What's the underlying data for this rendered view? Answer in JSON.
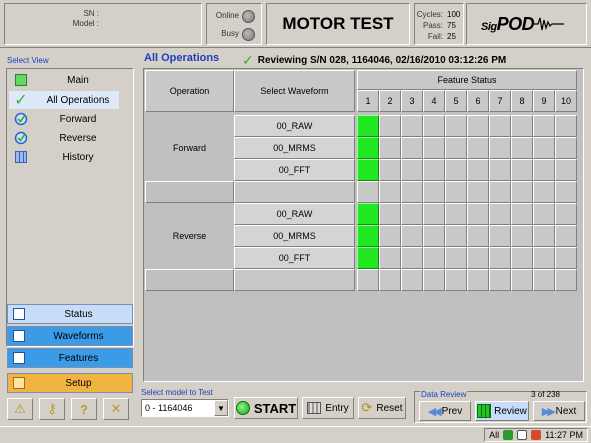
{
  "header": {
    "sn_label": "SN :",
    "model_label": "Model :",
    "online_label": "Online",
    "busy_label": "Busy",
    "title": "MOTOR TEST",
    "cycles_label": "Cycles:",
    "cycles_value": "100",
    "pass_label": "Pass:",
    "pass_value": "75",
    "fail_label": "Fail:",
    "fail_value": "25",
    "logo_pre": "Sig",
    "logo_main": "POD"
  },
  "sidebar": {
    "select_view_label": "Select View",
    "items": [
      {
        "label": "Main",
        "icon": "main-view-icon"
      },
      {
        "label": "All Operations",
        "icon": "check-icon"
      },
      {
        "label": "Forward",
        "icon": "forward-op-icon"
      },
      {
        "label": "Reverse",
        "icon": "reverse-op-icon"
      },
      {
        "label": "History",
        "icon": "history-icon"
      }
    ],
    "active_index": 1,
    "buttons": {
      "status": "Status",
      "waveforms": "Waveforms",
      "features": "Features",
      "setup": "Setup"
    },
    "tool_icons": [
      "warning-icon",
      "key-icon",
      "help-icon",
      "tools-icon"
    ]
  },
  "main": {
    "title": "All Operations",
    "review_text": "Reviewing S/N 028, 1164046, 02/16/2010 03:12:26 PM",
    "table": {
      "col_operation": "Operation",
      "col_waveform": "Select Waveform",
      "col_feature_status": "Feature Status",
      "feature_numbers": [
        "1",
        "2",
        "3",
        "4",
        "5",
        "6",
        "7",
        "8",
        "9",
        "10"
      ],
      "groups": [
        {
          "operation": "Forward",
          "rows": [
            {
              "waveform": "00_RAW",
              "status": [
                1,
                0,
                0,
                0,
                0,
                0,
                0,
                0,
                0,
                0
              ]
            },
            {
              "waveform": "00_MRMS",
              "status": [
                1,
                0,
                0,
                0,
                0,
                0,
                0,
                0,
                0,
                0
              ]
            },
            {
              "waveform": "00_FFT",
              "status": [
                1,
                0,
                0,
                0,
                0,
                0,
                0,
                0,
                0,
                0
              ]
            },
            {
              "waveform": "",
              "status": [
                0,
                0,
                0,
                0,
                0,
                0,
                0,
                0,
                0,
                0
              ]
            }
          ]
        },
        {
          "operation": "Reverse",
          "rows": [
            {
              "waveform": "00_RAW",
              "status": [
                1,
                0,
                0,
                0,
                0,
                0,
                0,
                0,
                0,
                0
              ]
            },
            {
              "waveform": "00_MRMS",
              "status": [
                1,
                0,
                0,
                0,
                0,
                0,
                0,
                0,
                0,
                0
              ]
            },
            {
              "waveform": "00_FFT",
              "status": [
                1,
                0,
                0,
                0,
                0,
                0,
                0,
                0,
                0,
                0
              ]
            },
            {
              "waveform": "",
              "status": [
                0,
                0,
                0,
                0,
                0,
                0,
                0,
                0,
                0,
                0
              ]
            }
          ]
        }
      ]
    }
  },
  "bottom": {
    "model_label": "Select model to Test",
    "model_value": "0 - 1164046",
    "start_label": "START",
    "entry_label": "Entry",
    "reset_label": "Reset",
    "data_review_label": "Data Review",
    "review_count": "3 of 238",
    "prev_label": "Prev",
    "review_label": "Review",
    "next_label": "Next"
  },
  "statusbar": {
    "filter": "All",
    "time": "11:27 PM"
  },
  "colors": {
    "pass": "#22e822",
    "accent_blue": "#1a3fbf",
    "setup_orange": "#f2b340"
  }
}
